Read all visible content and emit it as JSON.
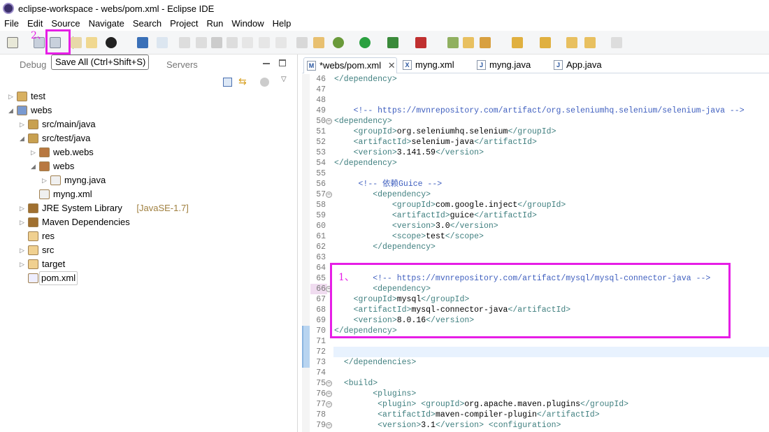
{
  "window": {
    "title": "eclipse-workspace - webs/pom.xml - Eclipse IDE"
  },
  "menu": [
    "File",
    "Edit",
    "Source",
    "Navigate",
    "Search",
    "Project",
    "Run",
    "Window",
    "Help"
  ],
  "toolbar": {
    "tooltip": "Save All (Ctrl+Shift+S)",
    "annotation": "2、",
    "highlight_color": "#e61ee6"
  },
  "left_panel": {
    "tabs": [
      {
        "label": "Debug"
      },
      {
        "label": "Servers"
      }
    ],
    "tree": [
      {
        "label": "test",
        "depth": 0,
        "expand": "collapsed",
        "icon": "java-project-icon"
      },
      {
        "label": "webs",
        "depth": 0,
        "expand": "expanded",
        "icon": "maven-project-icon"
      },
      {
        "label": "src/main/java",
        "depth": 1,
        "expand": "collapsed",
        "icon": "source-folder-icon"
      },
      {
        "label": "src/test/java",
        "depth": 1,
        "expand": "expanded",
        "icon": "source-folder-icon"
      },
      {
        "label": "web.webs",
        "depth": 2,
        "expand": "collapsed",
        "icon": "package-icon"
      },
      {
        "label": "webs",
        "depth": 2,
        "expand": "expanded",
        "icon": "package-icon"
      },
      {
        "label": "myng.java",
        "depth": 3,
        "expand": "collapsed",
        "icon": "java-file-icon"
      },
      {
        "label": "myng.xml",
        "depth": 2,
        "expand": "none",
        "icon": "xml-file-icon"
      },
      {
        "label": "JRE System Library",
        "suffix": "[JavaSE-1.7]",
        "depth": 1,
        "expand": "collapsed",
        "icon": "library-icon"
      },
      {
        "label": "Maven Dependencies",
        "depth": 1,
        "expand": "collapsed",
        "icon": "library-icon"
      },
      {
        "label": "res",
        "depth": 1,
        "expand": "none",
        "icon": "folder-icon"
      },
      {
        "label": "src",
        "depth": 1,
        "expand": "collapsed",
        "icon": "folder-icon"
      },
      {
        "label": "target",
        "depth": 1,
        "expand": "collapsed",
        "icon": "folder-icon"
      },
      {
        "label": "pom.xml",
        "depth": 1,
        "expand": "none",
        "icon": "pom-file-icon",
        "selected": true
      }
    ]
  },
  "editor": {
    "tabs": [
      {
        "label": "*webs/pom.xml",
        "icon": "M",
        "active": true
      },
      {
        "label": "myng.xml",
        "icon": "X"
      },
      {
        "label": "myng.java",
        "icon": "J"
      },
      {
        "label": "App.java",
        "icon": "J"
      }
    ],
    "annotation": "1、",
    "lines": [
      {
        "n": "46",
        "t": "</dependency>"
      },
      {
        "n": "47",
        "t": ""
      },
      {
        "n": "48",
        "t": ""
      },
      {
        "n": "49",
        "t": "    <!-- https://mvnrepository.com/artifact/org.seleniumhq.selenium/selenium-java -->"
      },
      {
        "n": "50",
        "t": "<dependency>",
        "fold": true
      },
      {
        "n": "51",
        "t": "    <groupId>org.seleniumhq.selenium</groupId>"
      },
      {
        "n": "52",
        "t": "    <artifactId>selenium-java</artifactId>"
      },
      {
        "n": "53",
        "t": "    <version>3.141.59</version>"
      },
      {
        "n": "54",
        "t": "</dependency>"
      },
      {
        "n": "55",
        "t": ""
      },
      {
        "n": "56",
        "t": "     <!-- 依赖Guice -->"
      },
      {
        "n": "57",
        "t": "        <dependency>",
        "fold": true
      },
      {
        "n": "58",
        "t": "            <groupId>com.google.inject</groupId>"
      },
      {
        "n": "59",
        "t": "            <artifactId>guice</artifactId>"
      },
      {
        "n": "60",
        "t": "            <version>3.0</version>"
      },
      {
        "n": "61",
        "t": "            <scope>test</scope>"
      },
      {
        "n": "62",
        "t": "        </dependency>"
      },
      {
        "n": "63",
        "t": ""
      },
      {
        "n": "64",
        "t": ""
      },
      {
        "n": "65",
        "t": "        <!-- https://mvnrepository.com/artifact/mysql/mysql-connector-java -->"
      },
      {
        "n": "66",
        "t": "        <dependency>",
        "fold": true
      },
      {
        "n": "67",
        "t": "    <groupId>mysql</groupId>"
      },
      {
        "n": "68",
        "t": "    <artifactId>mysql-connector-java</artifactId>"
      },
      {
        "n": "69",
        "t": "    <version>8.0.16</version>"
      },
      {
        "n": "70",
        "t": "</dependency>"
      },
      {
        "n": "71",
        "t": ""
      },
      {
        "n": "72",
        "t": ""
      },
      {
        "n": "73",
        "t": "  </dependencies>"
      },
      {
        "n": "74",
        "t": ""
      },
      {
        "n": "75",
        "t": "  <build>",
        "fold": true
      },
      {
        "n": "76",
        "t": "        <plugins>",
        "fold": true
      },
      {
        "n": "77",
        "t": "         <plugin> <groupId>org.apache.maven.plugins</groupId>",
        "fold": true
      },
      {
        "n": "78",
        "t": "         <artifactId>maven-compiler-plugin</artifactId>"
      },
      {
        "n": "79",
        "t": "         <version>3.1</version> <configuration>",
        "fold": true
      }
    ]
  }
}
